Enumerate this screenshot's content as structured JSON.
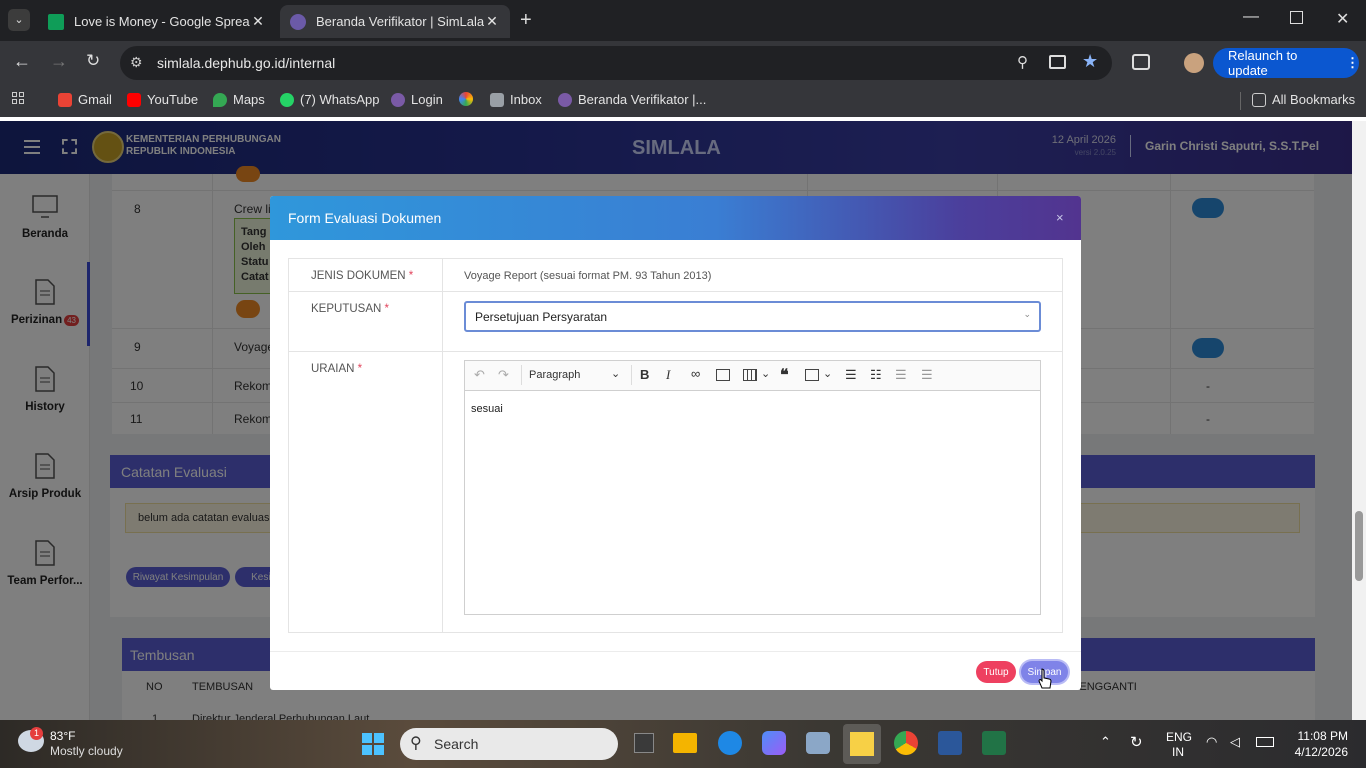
{
  "browser": {
    "tabs": [
      {
        "title": "Love is Money - Google Spread",
        "active": false
      },
      {
        "title": "Beranda Verifikator | SimLala",
        "active": true
      }
    ],
    "url": "simlala.dephub.go.id/internal",
    "relaunch_label": "Relaunch to update",
    "bookmarks": [
      "Gmail",
      "YouTube",
      "Maps",
      "(7) WhatsApp",
      "Login",
      "Inbox",
      "Beranda Verifikator |..."
    ],
    "all_bookmarks": "All Bookmarks"
  },
  "app": {
    "org_line1": "KEMENTERIAN PERHUBUNGAN",
    "org_line2": "REPUBLIK INDONESIA",
    "title": "SIMLALA",
    "date": "12 April 2026",
    "version": "versi 2.0.25",
    "user": "Garin Christi Saputri, S.S.T.Pel"
  },
  "sidebar": {
    "items": [
      {
        "label": "Beranda"
      },
      {
        "label": "Perizinan",
        "badge": "43"
      },
      {
        "label": "History"
      },
      {
        "label": "Arsip Produk"
      },
      {
        "label": "Team Perfor..."
      }
    ]
  },
  "background": {
    "rows": [
      {
        "no": "8",
        "text": "Crew lis"
      },
      {
        "no": "9",
        "text": "Voyage"
      },
      {
        "no": "10",
        "text": "Rekome"
      },
      {
        "no": "11",
        "text": "Rekome"
      }
    ],
    "row8_box": [
      "Tang",
      "Oleh",
      "Statu",
      "Catat"
    ],
    "catatan_title": "Catatan Evaluasi",
    "catatan_empty": "belum ada catatan evaluasi",
    "btn_riwayat": "Riwayat Kesimpulan",
    "btn_kesim": "Kesim",
    "tembusan_title": "Tembusan",
    "tembusan_cols": [
      "NO",
      "TEMBUSAN",
      "ESS PENGGANTI"
    ],
    "tembusan_row1": [
      "1",
      "Direktur Jenderal Perhubungan Laut"
    ],
    "dashes": [
      "-",
      "-"
    ]
  },
  "modal": {
    "title": "Form Evaluasi Dokumen",
    "jenis_label": "JENIS DOKUMEN",
    "jenis_value": "Voyage Report (sesuai format PM. 93 Tahun 2013)",
    "keputusan_label": "KEPUTUSAN",
    "keputusan_value": "Persetujuan Persyaratan",
    "uraian_label": "URAIAN",
    "editor_format": "Paragraph",
    "editor_content": "sesuai",
    "btn_close": "Tutup",
    "btn_save": "Simpan",
    "required_mark": "*"
  },
  "taskbar": {
    "weather_temp": "83°F",
    "weather_desc": "Mostly cloudy",
    "weather_badge": "1",
    "search": "Search",
    "lang1": "ENG",
    "lang2": "IN",
    "time": "11:08 PM",
    "date": "4/12/2026"
  },
  "colors": {
    "accent": "#5a5fd6",
    "danger": "#ee4060",
    "badge": "#e53e3e"
  }
}
